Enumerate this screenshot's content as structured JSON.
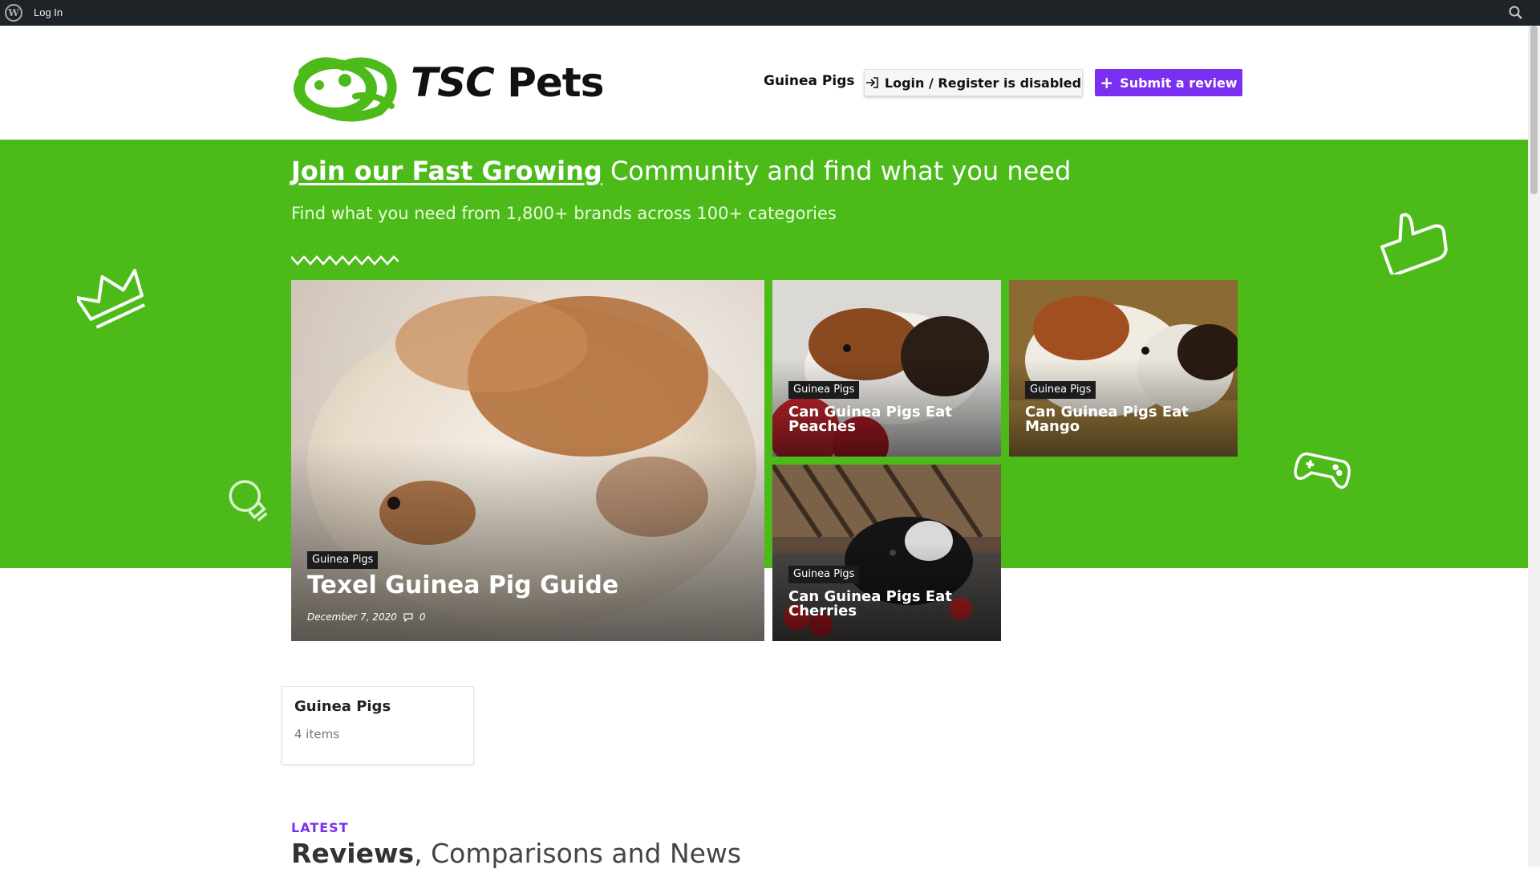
{
  "adminbar": {
    "login": "Log In"
  },
  "header": {
    "logo": "TSC Pets",
    "logo_tsc": "TSC",
    "logo_pets": "Pets",
    "nav": "Guinea Pigs",
    "login_button": "Login / Register is disabled",
    "submit_button": "Submit a review"
  },
  "hero": {
    "title_bold": "Join our Fast Growing",
    "title_rest": " Community and find what you need",
    "subtitle": "Find what you need from 1,800+ brands across 100+ categories"
  },
  "featured": {
    "main": {
      "tag": "Guinea Pigs",
      "title": "Texel Guinea Pig Guide",
      "date": "December 7, 2020",
      "comments": "0"
    },
    "peaches": {
      "tag": "Guinea Pigs",
      "title": "Can Guinea Pigs Eat Peaches"
    },
    "mango": {
      "tag": "Guinea Pigs",
      "title": "Can Guinea Pigs Eat Mango"
    },
    "cherries": {
      "tag": "Guinea Pigs",
      "title": "Can Guinea Pigs Eat Cherries"
    }
  },
  "category": {
    "name": "Guinea Pigs",
    "count": "4 items"
  },
  "latest": {
    "label": "LATEST",
    "title_bold": "Reviews",
    "title_rest": ", Comparisons and News"
  },
  "colors": {
    "green": "#4cbb1a",
    "purple": "#7b2ff0",
    "adminbar": "#1d2327"
  }
}
